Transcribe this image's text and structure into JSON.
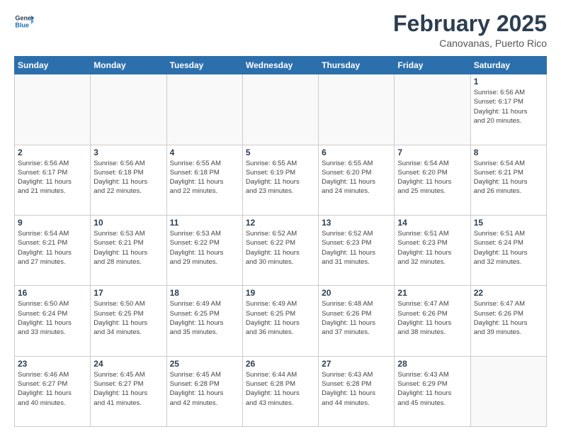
{
  "header": {
    "logo_line1": "General",
    "logo_line2": "Blue",
    "month": "February 2025",
    "location": "Canovanas, Puerto Rico"
  },
  "days_of_week": [
    "Sunday",
    "Monday",
    "Tuesday",
    "Wednesday",
    "Thursday",
    "Friday",
    "Saturday"
  ],
  "weeks": [
    [
      {
        "num": "",
        "info": ""
      },
      {
        "num": "",
        "info": ""
      },
      {
        "num": "",
        "info": ""
      },
      {
        "num": "",
        "info": ""
      },
      {
        "num": "",
        "info": ""
      },
      {
        "num": "",
        "info": ""
      },
      {
        "num": "1",
        "info": "Sunrise: 6:56 AM\nSunset: 6:17 PM\nDaylight: 11 hours\nand 20 minutes."
      }
    ],
    [
      {
        "num": "2",
        "info": "Sunrise: 6:56 AM\nSunset: 6:17 PM\nDaylight: 11 hours\nand 21 minutes."
      },
      {
        "num": "3",
        "info": "Sunrise: 6:56 AM\nSunset: 6:18 PM\nDaylight: 11 hours\nand 22 minutes."
      },
      {
        "num": "4",
        "info": "Sunrise: 6:55 AM\nSunset: 6:18 PM\nDaylight: 11 hours\nand 22 minutes."
      },
      {
        "num": "5",
        "info": "Sunrise: 6:55 AM\nSunset: 6:19 PM\nDaylight: 11 hours\nand 23 minutes."
      },
      {
        "num": "6",
        "info": "Sunrise: 6:55 AM\nSunset: 6:20 PM\nDaylight: 11 hours\nand 24 minutes."
      },
      {
        "num": "7",
        "info": "Sunrise: 6:54 AM\nSunset: 6:20 PM\nDaylight: 11 hours\nand 25 minutes."
      },
      {
        "num": "8",
        "info": "Sunrise: 6:54 AM\nSunset: 6:21 PM\nDaylight: 11 hours\nand 26 minutes."
      }
    ],
    [
      {
        "num": "9",
        "info": "Sunrise: 6:54 AM\nSunset: 6:21 PM\nDaylight: 11 hours\nand 27 minutes."
      },
      {
        "num": "10",
        "info": "Sunrise: 6:53 AM\nSunset: 6:21 PM\nDaylight: 11 hours\nand 28 minutes."
      },
      {
        "num": "11",
        "info": "Sunrise: 6:53 AM\nSunset: 6:22 PM\nDaylight: 11 hours\nand 29 minutes."
      },
      {
        "num": "12",
        "info": "Sunrise: 6:52 AM\nSunset: 6:22 PM\nDaylight: 11 hours\nand 30 minutes."
      },
      {
        "num": "13",
        "info": "Sunrise: 6:52 AM\nSunset: 6:23 PM\nDaylight: 11 hours\nand 31 minutes."
      },
      {
        "num": "14",
        "info": "Sunrise: 6:51 AM\nSunset: 6:23 PM\nDaylight: 11 hours\nand 32 minutes."
      },
      {
        "num": "15",
        "info": "Sunrise: 6:51 AM\nSunset: 6:24 PM\nDaylight: 11 hours\nand 32 minutes."
      }
    ],
    [
      {
        "num": "16",
        "info": "Sunrise: 6:50 AM\nSunset: 6:24 PM\nDaylight: 11 hours\nand 33 minutes."
      },
      {
        "num": "17",
        "info": "Sunrise: 6:50 AM\nSunset: 6:25 PM\nDaylight: 11 hours\nand 34 minutes."
      },
      {
        "num": "18",
        "info": "Sunrise: 6:49 AM\nSunset: 6:25 PM\nDaylight: 11 hours\nand 35 minutes."
      },
      {
        "num": "19",
        "info": "Sunrise: 6:49 AM\nSunset: 6:25 PM\nDaylight: 11 hours\nand 36 minutes."
      },
      {
        "num": "20",
        "info": "Sunrise: 6:48 AM\nSunset: 6:26 PM\nDaylight: 11 hours\nand 37 minutes."
      },
      {
        "num": "21",
        "info": "Sunrise: 6:47 AM\nSunset: 6:26 PM\nDaylight: 11 hours\nand 38 minutes."
      },
      {
        "num": "22",
        "info": "Sunrise: 6:47 AM\nSunset: 6:26 PM\nDaylight: 11 hours\nand 39 minutes."
      }
    ],
    [
      {
        "num": "23",
        "info": "Sunrise: 6:46 AM\nSunset: 6:27 PM\nDaylight: 11 hours\nand 40 minutes."
      },
      {
        "num": "24",
        "info": "Sunrise: 6:45 AM\nSunset: 6:27 PM\nDaylight: 11 hours\nand 41 minutes."
      },
      {
        "num": "25",
        "info": "Sunrise: 6:45 AM\nSunset: 6:28 PM\nDaylight: 11 hours\nand 42 minutes."
      },
      {
        "num": "26",
        "info": "Sunrise: 6:44 AM\nSunset: 6:28 PM\nDaylight: 11 hours\nand 43 minutes."
      },
      {
        "num": "27",
        "info": "Sunrise: 6:43 AM\nSunset: 6:28 PM\nDaylight: 11 hours\nand 44 minutes."
      },
      {
        "num": "28",
        "info": "Sunrise: 6:43 AM\nSunset: 6:29 PM\nDaylight: 11 hours\nand 45 minutes."
      },
      {
        "num": "",
        "info": ""
      }
    ]
  ]
}
